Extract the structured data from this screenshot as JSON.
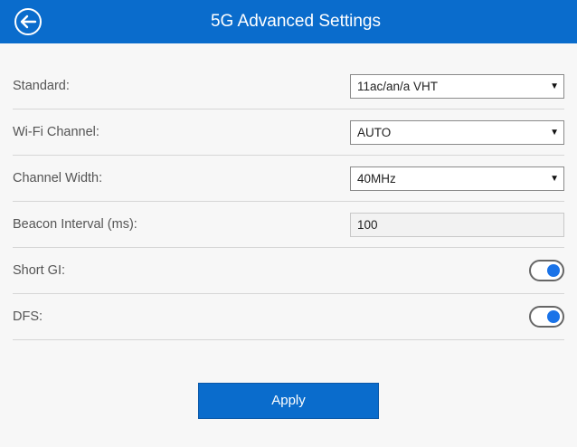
{
  "header": {
    "title": "5G Advanced Settings",
    "back_icon": "back-arrow-circle-icon",
    "bg_color": "#0a6ccc"
  },
  "settings": {
    "standard": {
      "label": "Standard:",
      "value": "11ac/an/a VHT"
    },
    "wifi_channel": {
      "label": "Wi-Fi Channel:",
      "value": "AUTO"
    },
    "channel_width": {
      "label": "Channel Width:",
      "value": "40MHz"
    },
    "beacon_interval": {
      "label": "Beacon Interval (ms):",
      "value": "100"
    },
    "short_gi": {
      "label": "Short GI:",
      "enabled": true
    },
    "dfs": {
      "label": "DFS:",
      "enabled": true
    }
  },
  "actions": {
    "apply_label": "Apply"
  },
  "colors": {
    "toggle_knob": "#1a73e8",
    "button": "#0a6ccc"
  }
}
